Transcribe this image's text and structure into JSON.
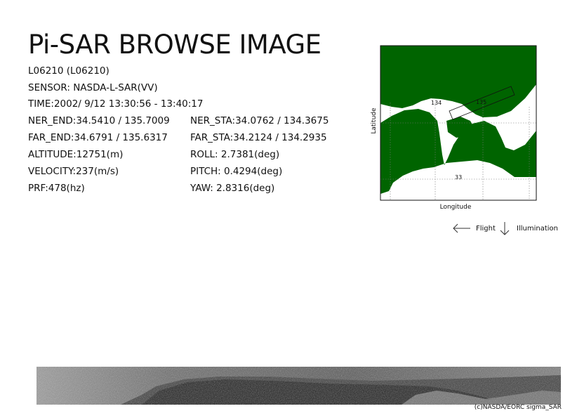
{
  "title": "Pi-SAR BROWSE IMAGE",
  "info": {
    "scene_id": "L06210 (L06210)",
    "sensor": "SENSOR: NASDA-L-SAR(VV)",
    "time": "TIME:2002/ 9/12  13:30:56 - 13:40:17",
    "ner_end": "NER_END:34.5410 / 135.7009",
    "far_end": "FAR_END:34.6791 / 135.6317",
    "altitude": "ALTITUDE:12751(m)",
    "velocity": "VELOCITY:237(m/s)",
    "prf": "PRF:478(hz)",
    "ner_sta": "NER_STA:34.0762 / 134.3675",
    "far_sta": "FAR_STA:34.2124 / 134.2935",
    "roll": "ROLL: 2.7381(deg)",
    "pitch": "PITCH:  0.4294(deg)",
    "yaw": "YAW:   2.8316(deg)"
  },
  "map": {
    "y_label": "Latitude",
    "x_label": "Longitude",
    "grid_label_134": "134",
    "grid_label_135": "135",
    "grid_label_33": "33",
    "land_color": "#006400",
    "water_color": "#ffffff"
  },
  "legend": {
    "flight_label": "Flight",
    "illumination_label": "Illumination"
  },
  "credit": "(c)NASDA/EORC sigma_SAR"
}
